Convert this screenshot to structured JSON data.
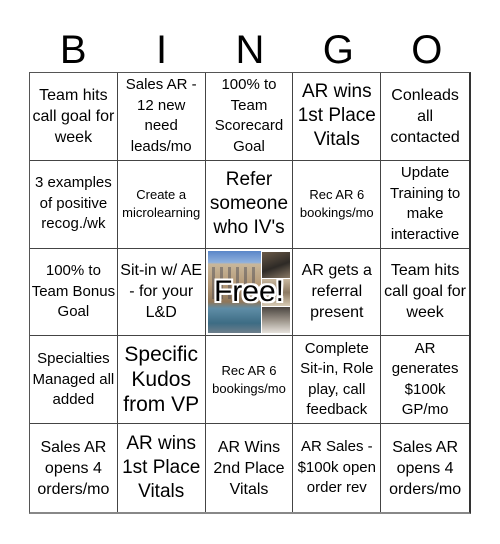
{
  "header": {
    "letters": [
      "B",
      "I",
      "N",
      "G",
      "O"
    ]
  },
  "cells": [
    "Team hits call goal for week",
    "Sales AR - 12 new need leads/mo",
    "100% to Team Scorecard Goal",
    "AR wins 1st Place Vitals",
    "Conleads all contacted",
    "3 examples of positive recog./wk",
    "Create a microlearning",
    "Refer someone who IV's",
    "Rec AR 6 bookings/mo",
    "Update Training to make interactive",
    "100% to Team Bonus Goal",
    "Sit-in w/ AE - for your L&D",
    "Free!",
    "AR gets a referral present",
    "Team hits call goal for week",
    "Specialties Managed all added",
    "Specific Kudos from VP",
    "Rec AR 6 bookings/mo",
    "Complete Sit-in, Role play, call feedback",
    "AR generates $100k GP/mo",
    "Sales AR opens 4 orders/mo",
    "AR wins 1st Place Vitals",
    "AR Wins 2nd Place Vitals",
    "AR Sales - $100k open order rev",
    "Sales AR opens 4 orders/mo"
  ],
  "free_space": {
    "label": "Free!",
    "image": "building-photo-collage"
  }
}
